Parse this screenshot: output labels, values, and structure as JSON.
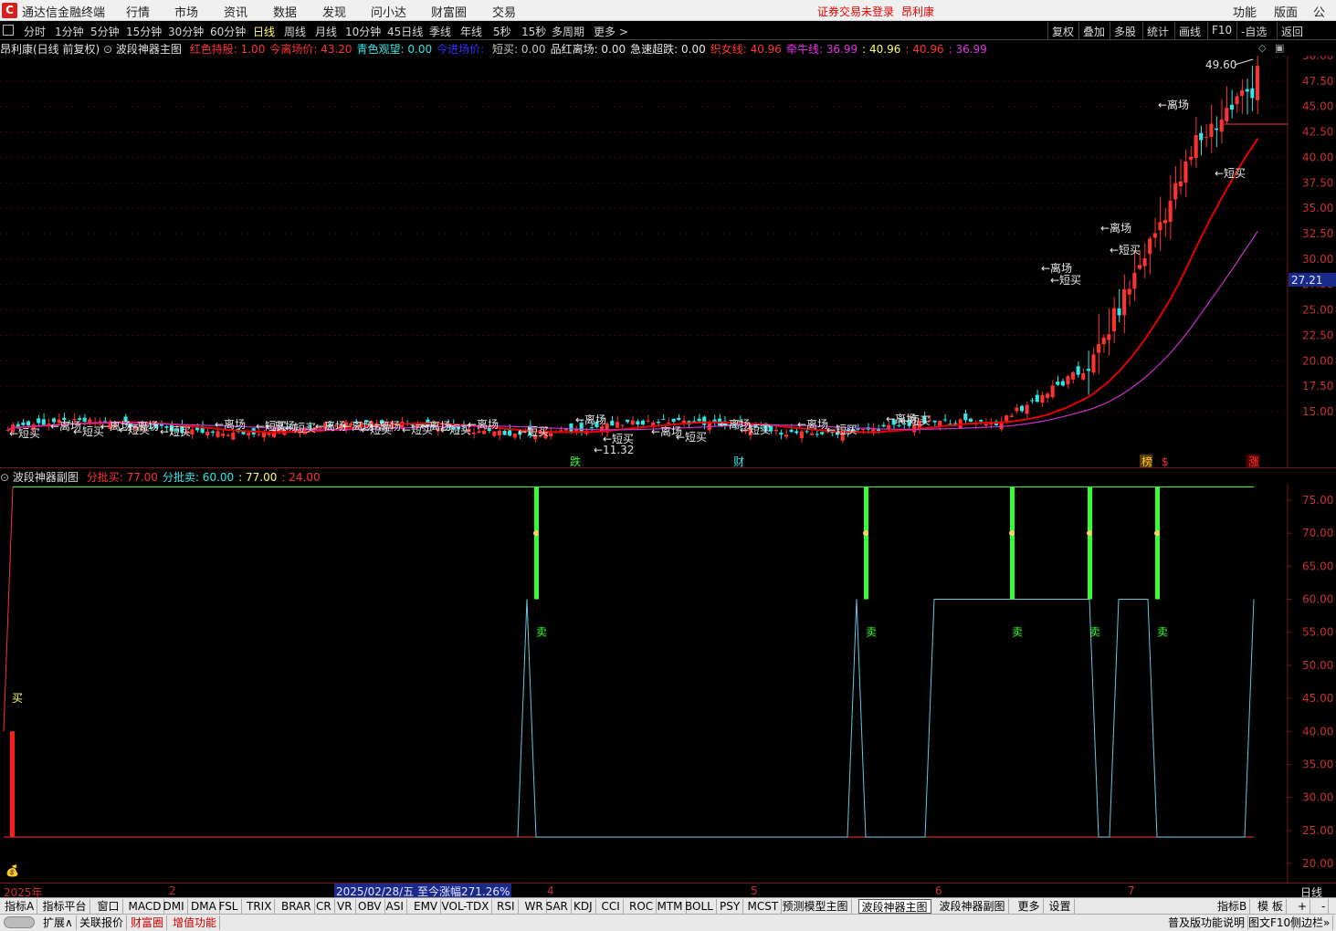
{
  "app": {
    "title": "通达信金融终端",
    "menus": [
      "行情",
      "市场",
      "资讯",
      "数据",
      "发现",
      "问小达",
      "财富圈",
      "交易"
    ],
    "login_status": "证券交易未登录",
    "stock_name_top": "昂利康",
    "right_menus": [
      "功能",
      "版面",
      "公式"
    ]
  },
  "period_bar": {
    "items": [
      "分时",
      "1分钟",
      "5分钟",
      "15分钟",
      "30分钟",
      "60分钟",
      "日线",
      "周线",
      "月线",
      "10分钟",
      "45日线",
      "季线",
      "年线",
      "5秒",
      "15秒",
      "多周期",
      "更多 >"
    ],
    "active": "日线",
    "right_buttons": [
      "复权",
      "叠加",
      "多股",
      "统计",
      "画线",
      "F10",
      "-自选",
      "返回"
    ]
  },
  "main_header": {
    "stock": "昂利康(日线 前复权)",
    "indicator": "波段神器主图",
    "fields": [
      {
        "label": "红色持股:",
        "value": "1.00",
        "color": "#ff3232"
      },
      {
        "label": "今离场价:",
        "value": "43.20",
        "color": "#ff3232"
      },
      {
        "label": "青色观望:",
        "value": "0.00",
        "color": "#32e6e6"
      },
      {
        "label": "今进场价:",
        "value": "",
        "color": "#3232ff"
      },
      {
        "label": "短买:",
        "value": "0.00",
        "color": "#c8c8c8"
      },
      {
        "label": "品红离场:",
        "value": "0.00",
        "color": "#e8e8e8"
      },
      {
        "label": "急速超跌:",
        "value": "0.00",
        "color": "#e8e8e8"
      },
      {
        "label": "织女线:",
        "value": "40.96",
        "color": "#ff3232"
      },
      {
        "label": "牵牛线:",
        "value": "36.99",
        "color": "#e632e6"
      },
      {
        "label": ":",
        "value": "40.96",
        "color": "#ffff66"
      },
      {
        "label": ":",
        "value": "40.96",
        "color": "#ff3232"
      },
      {
        "label": ":",
        "value": "36.99",
        "color": "#e632e6"
      }
    ],
    "high_label": "49.60",
    "current_price_tag": "27.21",
    "low_label": "11.32",
    "event_labels": [
      "跌",
      "财",
      "榜",
      "$",
      "涨"
    ]
  },
  "main_axis": [
    "50.00",
    "47.50",
    "45.00",
    "42.50",
    "40.00",
    "37.50",
    "35.00",
    "32.50",
    "30.00",
    "27.50",
    "25.00",
    "22.50",
    "20.00",
    "17.50",
    "15.00"
  ],
  "signals": {
    "exit": "←离场",
    "short_buy": "←短买",
    "buy": "买",
    "sell": "卖"
  },
  "sub_header": {
    "indicator": "波段神器副图",
    "fields": [
      {
        "label": "分批买:",
        "value": "77.00",
        "color": "#ff3232"
      },
      {
        "label": "分批卖:",
        "value": "60.00",
        "color": "#32e6e6"
      },
      {
        "label": ":",
        "value": "77.00",
        "color": "#ffff66"
      },
      {
        "label": ":",
        "value": "24.00",
        "color": "#ff3232"
      }
    ]
  },
  "sub_axis": [
    "75.00",
    "70.00",
    "65.00",
    "60.00",
    "55.00",
    "50.00",
    "45.00",
    "40.00",
    "35.00",
    "30.00",
    "25.00",
    "20.00"
  ],
  "x_axis": {
    "labels": [
      "2025年",
      "2",
      "4",
      "5",
      "6",
      "7"
    ],
    "highlight": "2025/02/28/五  至今涨幅271.26%",
    "period_label": "日线"
  },
  "tabs_row1": [
    "指标A",
    "指标平台",
    "窗口",
    "MACD",
    "DMI",
    "DMA",
    "FSL",
    "TRIX",
    "BRAR",
    "CR",
    "VR",
    "OBV",
    "ASI",
    "EMV",
    "VOL-TDX",
    "RSI",
    "WR",
    "SAR",
    "KDJ",
    "CCI",
    "ROC",
    "MTM",
    "BOLL",
    "PSY",
    "MCST",
    "预测模型主图",
    "波段神器主图",
    "波段神器副图",
    "更多",
    "设置"
  ],
  "tabs_row1_active": "波段神器主图",
  "tabs_row1_right": [
    "指标B",
    "模 板",
    "+",
    "-"
  ],
  "tabs_row2": [
    "扩展∧",
    "关联报价",
    "财富圈",
    "增值功能"
  ],
  "tabs_row2_right": [
    "普及版功能说明",
    "图文F10",
    "侧边栏»"
  ],
  "colors": {
    "up": "#ff3232",
    "down": "#32e6e6",
    "ma_red": "#e60000",
    "ma_purple": "#c832c8",
    "sell_bar": "#32ff32"
  }
}
